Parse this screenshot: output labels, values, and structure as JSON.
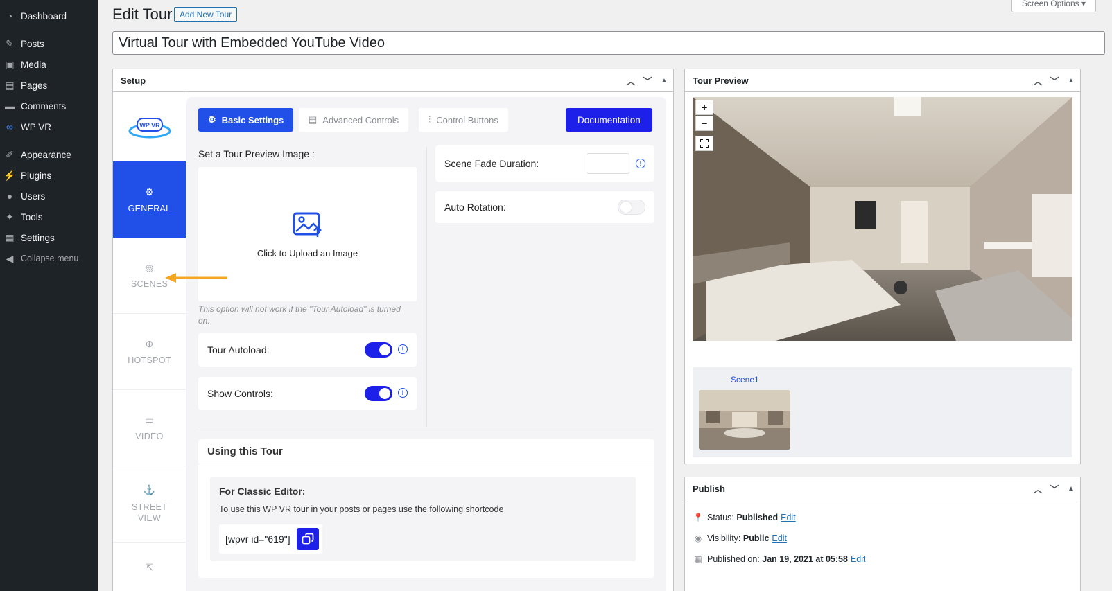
{
  "admin_menu": {
    "items": [
      {
        "label": "Dashboard",
        "icon": "dashboard-icon"
      },
      {
        "label": "Posts",
        "icon": "pin-icon"
      },
      {
        "label": "Media",
        "icon": "media-icon"
      },
      {
        "label": "Pages",
        "icon": "pages-icon"
      },
      {
        "label": "Comments",
        "icon": "comments-icon"
      },
      {
        "label": "WP VR",
        "icon": "vr-icon"
      },
      {
        "label": "Appearance",
        "icon": "brush-icon"
      },
      {
        "label": "Plugins",
        "icon": "plug-icon"
      },
      {
        "label": "Users",
        "icon": "users-icon"
      },
      {
        "label": "Tools",
        "icon": "wrench-icon"
      },
      {
        "label": "Settings",
        "icon": "settings-icon"
      },
      {
        "label": "Collapse menu",
        "icon": "collapse-icon"
      }
    ]
  },
  "header": {
    "title": "Edit Tour",
    "add_new": "Add New Tour",
    "screen_options": "Screen Options ▾"
  },
  "post_title": "Virtual Tour with Embedded YouTube Video",
  "setup": {
    "title": "Setup",
    "logo_text": "WP VR",
    "side_tabs": [
      "GENERAL",
      "SCENES",
      "HOTSPOT",
      "VIDEO",
      "STREET VIEW"
    ],
    "tabs": {
      "basic": "Basic Settings",
      "advanced": "Advanced Controls",
      "control_buttons": "Control Buttons",
      "documentation": "Documentation"
    },
    "preview_label": "Set a Tour Preview Image :",
    "upload_text": "Click to Upload an Image",
    "upload_note": "This option will not work if the \"Tour Autoload\" is turned on.",
    "tour_autoload": "Tour Autoload:",
    "show_controls": "Show Controls:",
    "scene_fade": "Scene Fade Duration:",
    "auto_rotation": "Auto Rotation:",
    "using_title": "Using this Tour",
    "classic_title": "For Classic Editor:",
    "classic_desc": "To use this WP VR tour in your posts or pages use the following shortcode",
    "shortcode": "[wpvr id=\"619\"]"
  },
  "preview": {
    "title": "Tour Preview",
    "zoom_in": "+",
    "zoom_out": "−",
    "scene_name": "Scene1"
  },
  "publish": {
    "title": "Publish",
    "status_label": "Status:",
    "status_value": "Published",
    "visibility_label": "Visibility:",
    "visibility_value": "Public",
    "published_label": "Published on:",
    "published_value": "Jan 19, 2021 at 05:58",
    "edit": "Edit"
  },
  "colors": {
    "accent": "#2050e8",
    "button_blue": "#1c20e8",
    "admin_bg": "#1d2327",
    "arrow": "#f5a623"
  }
}
